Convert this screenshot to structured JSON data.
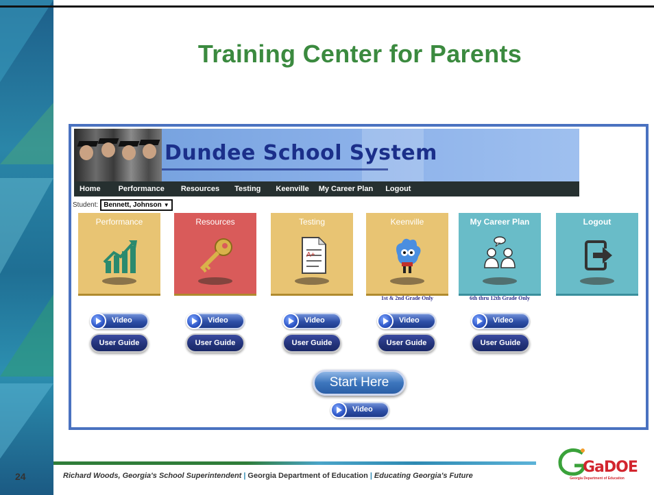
{
  "slide": {
    "title": "Training Center for Parents",
    "page_number": "24"
  },
  "portal": {
    "banner_title": "Dundee School System",
    "nav": [
      "Home",
      "Performance",
      "Resources",
      "Testing",
      "Keenville",
      "My Career Plan",
      "Logout"
    ],
    "student_label": "Student:",
    "student_value": "Bennett, Johnson",
    "tiles": [
      {
        "label": "Performance",
        "color": "#e8c473",
        "icon": "chart-icon",
        "note": ""
      },
      {
        "label": "Resources",
        "color": "#d95b5a",
        "icon": "key-icon",
        "note": ""
      },
      {
        "label": "Testing",
        "color": "#e8c473",
        "icon": "test-document-icon",
        "note": ""
      },
      {
        "label": "Keenville",
        "color": "#e8c473",
        "icon": "keenville-character-icon",
        "note": "1st & 2nd Grade Only"
      },
      {
        "label": "My Career Plan",
        "color": "#69bcc8",
        "icon": "people-chat-icon",
        "note": "6th thru 12th Grade Only"
      },
      {
        "label": "Logout",
        "color": "#69bcc8",
        "icon": "logout-icon",
        "note": ""
      }
    ],
    "video_label": "Video",
    "guide_label": "User Guide",
    "start_label": "Start Here"
  },
  "footer": {
    "superintendent": "Richard Woods, Georgia's School Superintendent",
    "department": "Georgia Department of Education",
    "motto": "Educating Georgia's Future",
    "logo_text": "GaDOE",
    "logo_sub": "Georgia Department of Education"
  }
}
